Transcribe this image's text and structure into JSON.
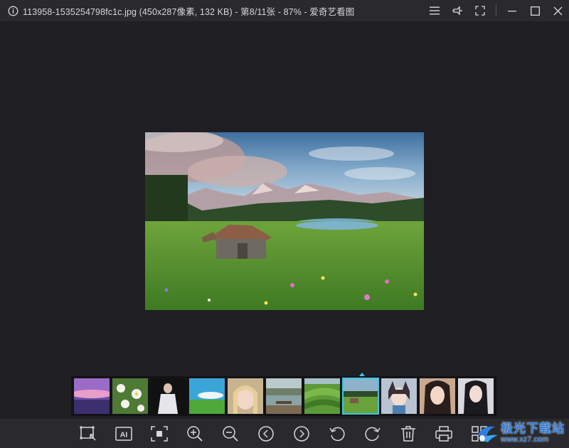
{
  "window": {
    "title": "113958-1535254798fc1c.jpg (450x287像素, 132 KB) - 第8/11张 - 87% - 爱奇艺看图",
    "controls": [
      {
        "name": "menu-icon"
      },
      {
        "name": "pin-icon"
      },
      {
        "name": "fullscreen-icon"
      },
      {
        "name": "minimize-icon"
      },
      {
        "name": "maximize-icon"
      },
      {
        "name": "close-icon"
      }
    ]
  },
  "viewer": {
    "image_subject": "alpine-meadow-with-wooden-hut",
    "zoom_percent": 87,
    "image_index": 8,
    "image_count": 11
  },
  "thumbnails": [
    {
      "subject": "purple-sunset-sea"
    },
    {
      "subject": "white-daisies"
    },
    {
      "subject": "woman-in-white-dress"
    },
    {
      "subject": "blue-sky-green-field"
    },
    {
      "subject": "blonde-portrait"
    },
    {
      "subject": "lake-bench"
    },
    {
      "subject": "green-hills"
    },
    {
      "subject": "alpine-meadow",
      "active": true
    },
    {
      "subject": "catgirl-illustration"
    },
    {
      "subject": "dark-hair-portrait"
    },
    {
      "subject": "dark-hair-portrait-2"
    }
  ],
  "toolbar": {
    "buttons": [
      {
        "name": "crop-select-icon"
      },
      {
        "name": "ai-icon",
        "label": "AI"
      },
      {
        "name": "actual-size-icon"
      },
      {
        "name": "zoom-in-icon"
      },
      {
        "name": "zoom-out-icon"
      },
      {
        "name": "previous-icon"
      },
      {
        "name": "next-icon"
      },
      {
        "name": "rotate-left-icon"
      },
      {
        "name": "rotate-right-icon"
      },
      {
        "name": "delete-icon"
      },
      {
        "name": "print-icon"
      },
      {
        "name": "grid-view-icon"
      }
    ]
  },
  "watermark": {
    "cn": "极光下载站",
    "url": "www.xz7.com"
  },
  "colors": {
    "accent": "#3cc6e6",
    "background": "#1f1f23",
    "chrome": "#2a2a2e",
    "icon": "#d8d8dc"
  }
}
